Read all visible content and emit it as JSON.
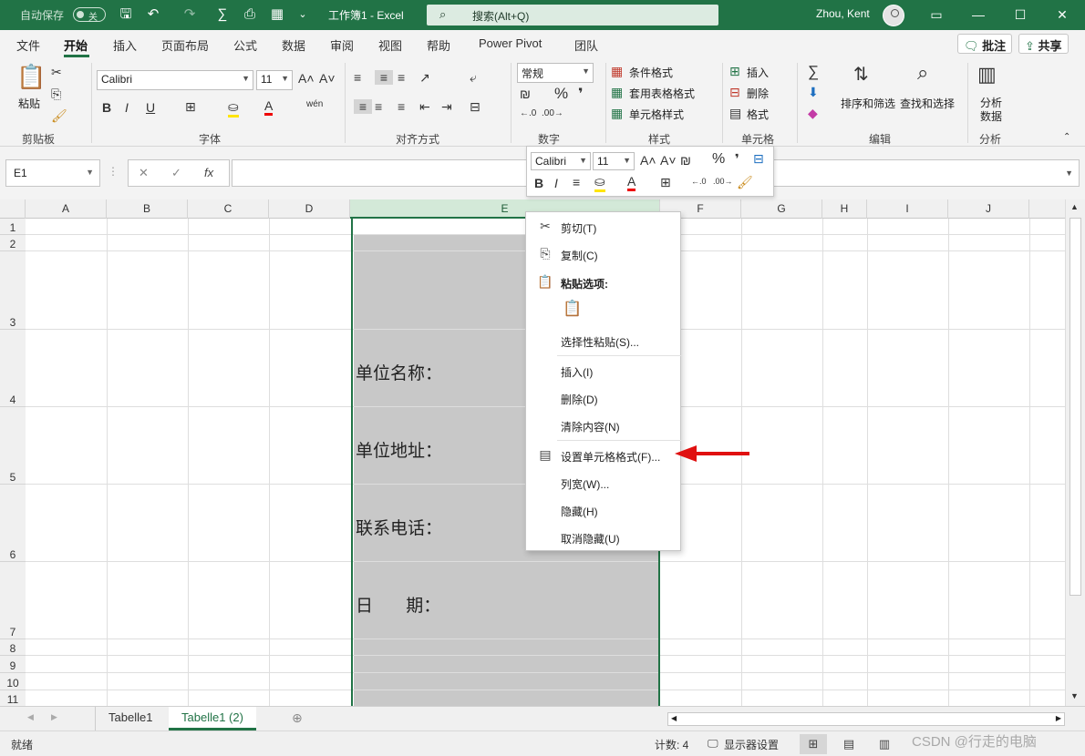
{
  "titlebar": {
    "autosave_label": "自动保存",
    "autosave_state": "关",
    "doc_title": "工作簿1  -  Excel",
    "search_placeholder": "搜索(Alt+Q)",
    "user_name": "Zhou, Kent",
    "bg_color": "#217346"
  },
  "ribbon_tabs": [
    "文件",
    "开始",
    "插入",
    "页面布局",
    "公式",
    "数据",
    "审阅",
    "视图",
    "帮助",
    "Power Pivot",
    "团队"
  ],
  "ribbon_buttons": {
    "comments": "批注",
    "share": "共享"
  },
  "ribbon": {
    "clipboard": {
      "paste": "粘贴",
      "label": "剪贴板"
    },
    "font": {
      "name": "Calibri",
      "size": "11",
      "label": "字体"
    },
    "alignment": {
      "label": "对齐方式"
    },
    "number": {
      "format": "常规",
      "label": "数字"
    },
    "styles": {
      "conditional": "条件格式",
      "table": "套用表格格式",
      "cell": "单元格样式",
      "label": "样式"
    },
    "cells": {
      "insert": "插入",
      "delete": "删除",
      "format": "格式",
      "label": "单元格"
    },
    "editing": {
      "sort": "排序和筛选",
      "find": "查找和选择",
      "label": "编辑"
    },
    "analysis": {
      "btn1": "分析",
      "btn2": "数据",
      "label": "分析"
    }
  },
  "formula_bar": {
    "name_box": "E1",
    "fx": "fx",
    "formula": ""
  },
  "columns": [
    "A",
    "B",
    "C",
    "D",
    "E",
    "F",
    "G",
    "H",
    "I",
    "J"
  ],
  "rows": [
    "1",
    "2",
    "3",
    "4",
    "5",
    "6",
    "7",
    "8",
    "9",
    "10",
    "11"
  ],
  "cells": {
    "e4": "单位名称：",
    "e5": "单位地址：",
    "e6": "联系电话：",
    "e7": "日      期："
  },
  "minibar": {
    "font": "Calibri",
    "size": "11"
  },
  "context_menu": {
    "cut": "剪切(T)",
    "copy": "复制(C)",
    "paste_options": "粘贴选项:",
    "paste_special": "选择性粘贴(S)...",
    "insert": "插入(I)",
    "delete": "删除(D)",
    "clear": "清除内容(N)",
    "format_cells": "设置单元格格式(F)...",
    "col_width": "列宽(W)...",
    "hide": "隐藏(H)",
    "unhide": "取消隐藏(U)"
  },
  "sheets": [
    "Tabelle1",
    "Tabelle1 (2)"
  ],
  "status": {
    "ready": "就绪",
    "count": "计数: 4",
    "display": "显示器设置",
    "watermark": "CSDN @行走的电脑"
  }
}
